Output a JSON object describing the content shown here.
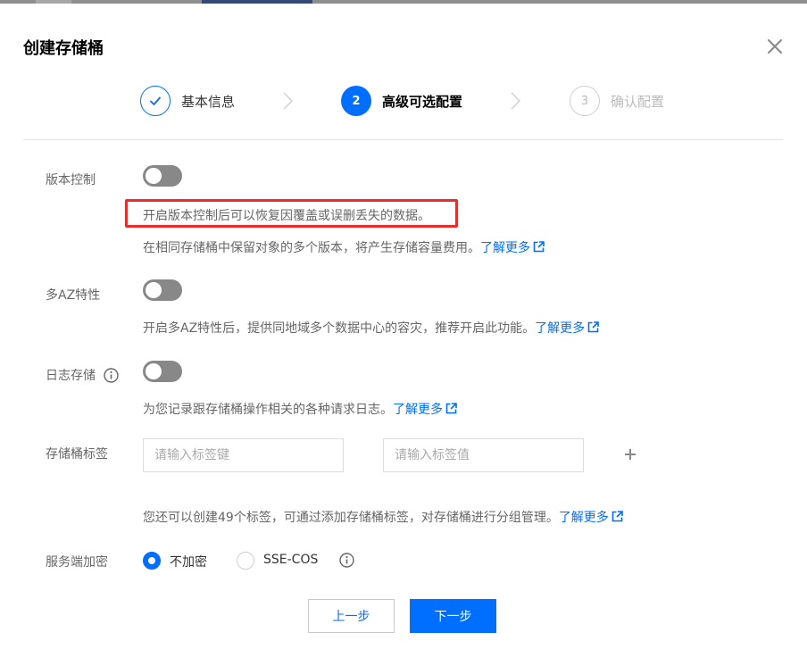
{
  "dialog": {
    "title": "创建存储桶"
  },
  "steps": [
    {
      "number": "1",
      "label": "基本信息",
      "state": "done"
    },
    {
      "number": "2",
      "label": "高级可选配置",
      "state": "active"
    },
    {
      "number": "3",
      "label": "确认配置",
      "state": "todo"
    }
  ],
  "versioning": {
    "label": "版本控制",
    "enabled": false,
    "highlight_text": "开启版本控制后可以恢复因覆盖或误删丢失的数据。",
    "hint": "在相同存储桶中保留对象的多个版本，将产生存储容量费用。",
    "link": "了解更多"
  },
  "multi_az": {
    "label": "多AZ特性",
    "enabled": false,
    "hint": "开启多AZ特性后，提供同地域多个数据中心的容灾，推荐开启此功能。",
    "link": "了解更多"
  },
  "logging": {
    "label": "日志存储",
    "enabled": false,
    "hint": "为您记录跟存储桶操作相关的各种请求日志。",
    "link": "了解更多"
  },
  "tags": {
    "label": "存储桶标签",
    "key_placeholder": "请输入标签键",
    "value_placeholder": "请输入标签值",
    "hint": "您还可以创建49个标签，可通过添加存储桶标签，对存储桶进行分组管理。",
    "link": "了解更多"
  },
  "encryption": {
    "label": "服务端加密",
    "options": [
      {
        "label": "不加密",
        "selected": true
      },
      {
        "label": "SSE-COS",
        "selected": false
      }
    ]
  },
  "footer": {
    "prev_label": "上一步",
    "next_label": "下一步"
  },
  "colors": {
    "accent": "#006eff",
    "highlight_border": "#e82d2d",
    "toggle_off": "#888888"
  }
}
